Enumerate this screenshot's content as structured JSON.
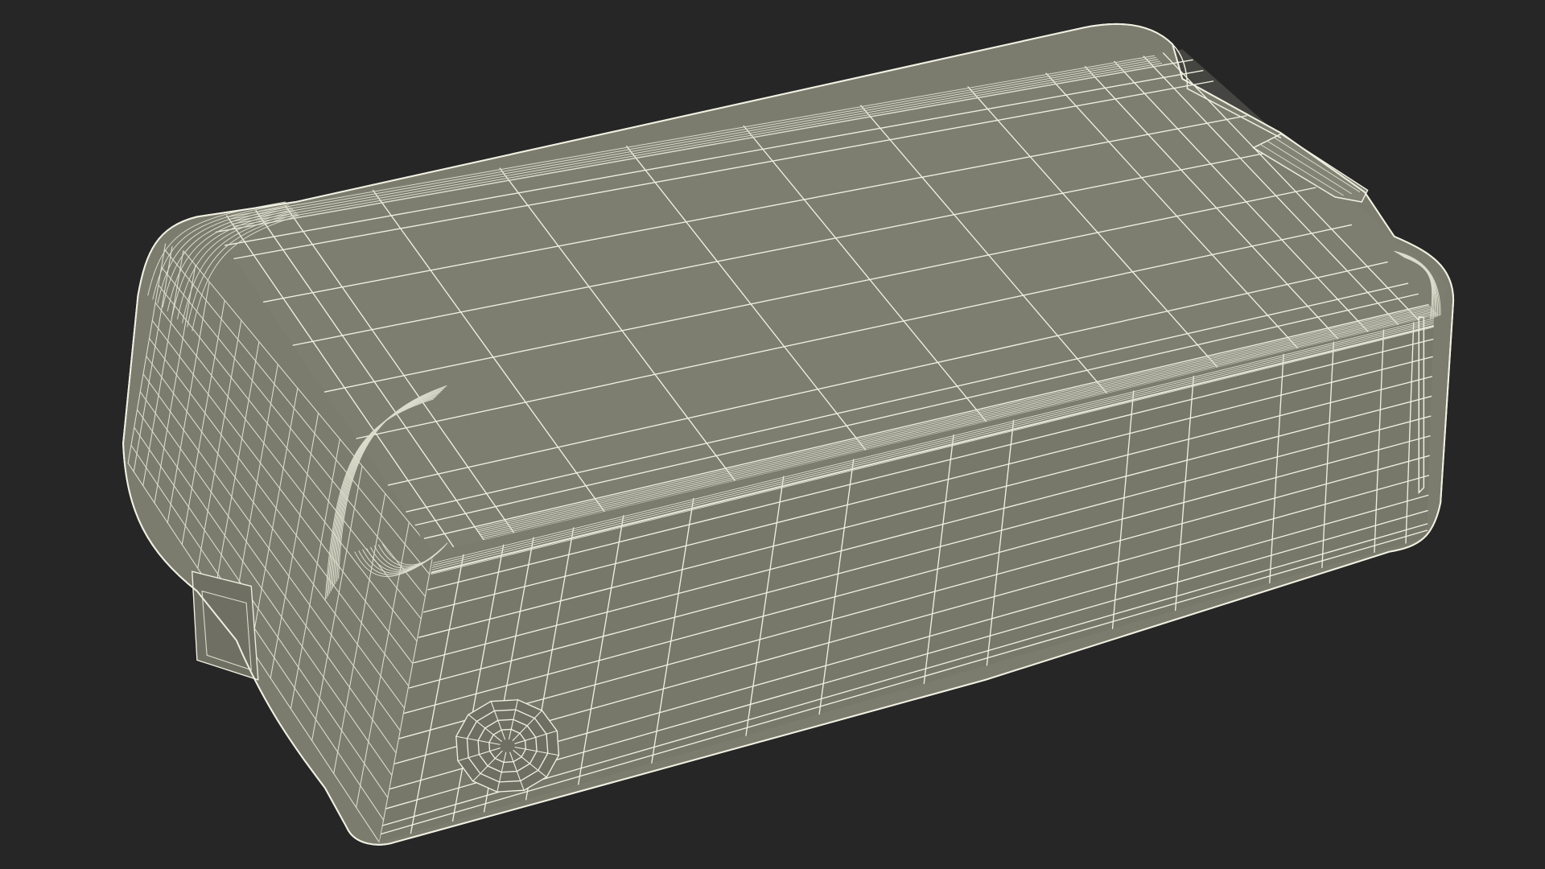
{
  "scene": {
    "subject": "wireframe-box",
    "colors": {
      "background": "#262626",
      "surface": "#7b7b6e",
      "surface_dark": "#6f6f63",
      "surface_light": "#828275",
      "wire": "#f0f0e2",
      "wire_dim": "#dcdccc"
    }
  }
}
